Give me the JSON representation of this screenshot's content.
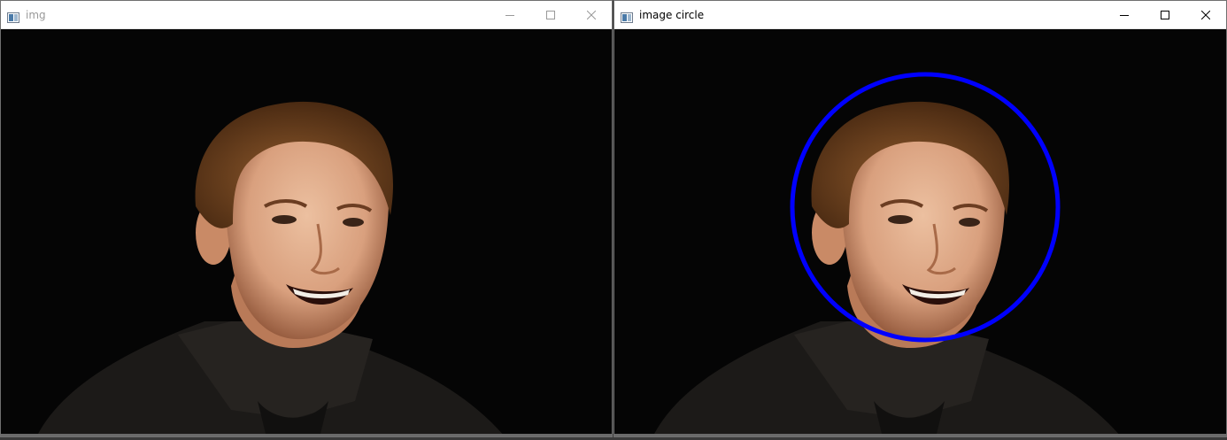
{
  "windows": {
    "left": {
      "title": "img",
      "controls": {
        "minimize": "minimize-icon",
        "maximize": "maximize-icon",
        "close": "close-icon"
      }
    },
    "right": {
      "title": "image circle",
      "controls": {
        "minimize": "minimize-icon",
        "maximize": "maximize-icon",
        "close": "close-icon"
      },
      "overlay": {
        "shape": "circle",
        "color": "#0000ff"
      }
    }
  },
  "colors": {
    "background": "#050505",
    "skin": "#d9a07e",
    "skin_shadow": "#8a4f33",
    "hair": "#7a4a22",
    "sweater": "#1c1a18",
    "circle": "#0000ff"
  }
}
